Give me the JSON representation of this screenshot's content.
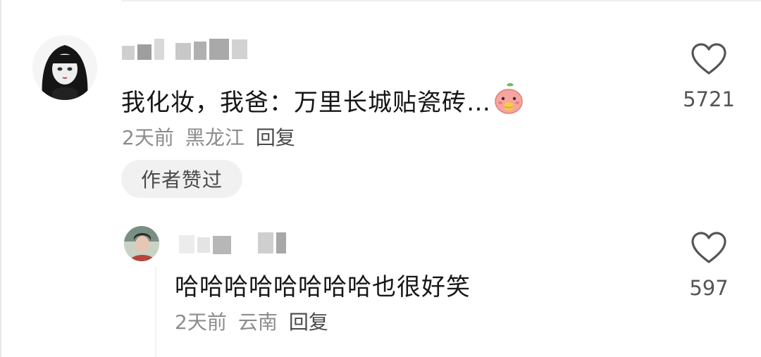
{
  "comment": {
    "text": "我化妆，我爸：万里长城贴瓷砖…",
    "emoji_icon": "peach-eating-emoji",
    "time": "2天前",
    "location": "黑龙江",
    "reply_label": "回复",
    "author_liked_badge": "作者赞过",
    "like_count": "5721"
  },
  "reply": {
    "text": "哈哈哈哈哈哈哈哈也很好笑",
    "time": "2天前",
    "location": "云南",
    "reply_label": "回复",
    "like_count": "597"
  },
  "icons": {
    "like": "heart-outline-icon"
  },
  "colors": {
    "primary_text": "#161616",
    "secondary_text": "#8c8c8c",
    "badge_background": "#f1f1f1",
    "icon_stroke": "#555555"
  }
}
